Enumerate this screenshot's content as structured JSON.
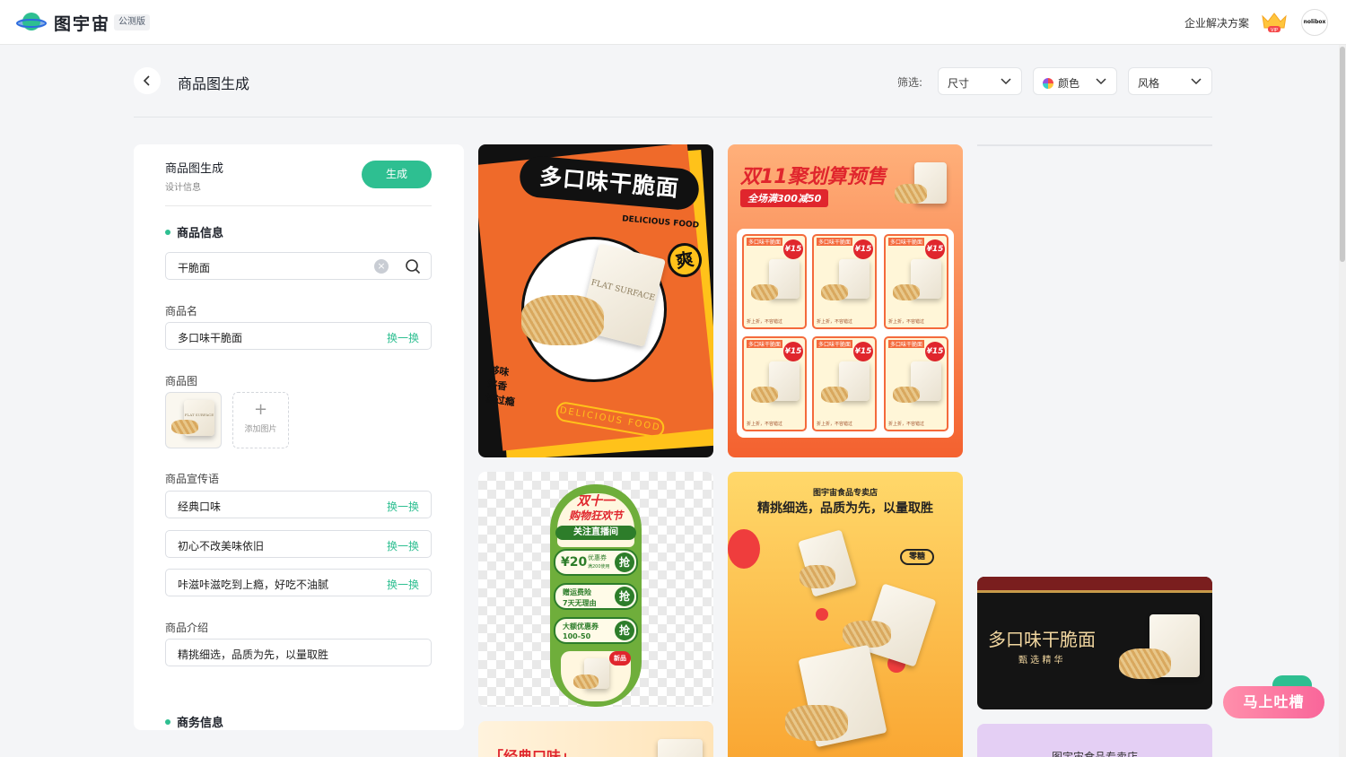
{
  "app": {
    "brand": "图宇宙",
    "beta_badge": "公测版",
    "enterprise_link": "企业解决方案",
    "avatar_text": "nolibox",
    "accent_color": "#2ebf91"
  },
  "header": {
    "title": "商品图生成",
    "filter_label": "筛选:",
    "filters": [
      {
        "label": "尺寸"
      },
      {
        "label": "颜色"
      },
      {
        "label": "风格"
      }
    ]
  },
  "panel": {
    "title": "商品图生成",
    "subtitle": "设计信息",
    "generate_button": "生成",
    "section_product": "商品信息",
    "search_value": "干脆面",
    "name_label": "商品名",
    "name_value": "多口味干脆面",
    "swap_label": "换一换",
    "image_label": "商品图",
    "add_image": "添加图片",
    "slogan_label": "商品宣传语",
    "slogans": [
      "经典口味",
      "初心不改美味依旧",
      "咔滋咔滋吃到上瘾，好吃不油腻"
    ],
    "intro_label": "商品介绍",
    "intro_value": "精挑细选，品质为先，以量取胜",
    "section_business": "商务信息"
  },
  "cards": {
    "c1": {
      "headline": "多口味干脆面",
      "sub": "DELICIOUS FOOD",
      "badge": "爽",
      "lines": [
        "够味",
        "够香",
        "够过瘾"
      ],
      "pill": "DELICIOUS FOOD",
      "bag_text": "FLAT SURFACE"
    },
    "c2": {
      "headline": "双11聚划算预售",
      "promo": "全场满300减50",
      "item_title": "多口味干脆面",
      "price": "¥15",
      "item_foot": "折上折，不容错过"
    },
    "c3": {
      "top": "双十一",
      "top2": "购物狂欢节",
      "live": "关注直播间",
      "coupon_amount": "¥20",
      "coupon_title": "优惠券",
      "coupon_note": "满200使用",
      "grab": "抢",
      "ship1": "赠运费险",
      "ship2": "7天无理由",
      "big1": "大额优惠券",
      "big2": "100-50",
      "new_badge": "新品"
    },
    "c4": {
      "shop": "图宇宙食品专卖店",
      "headline": "精挑细选，品质为先，以量取胜",
      "badge": "零糖"
    },
    "c5": {
      "headline": "「经典口味」"
    },
    "c6": {
      "headline": "多口味干脆面",
      "sub": "甄 选 精 华"
    },
    "c7": {
      "headline": "图宇宙食品专卖店"
    }
  },
  "feedback": {
    "label": "马上吐槽"
  }
}
